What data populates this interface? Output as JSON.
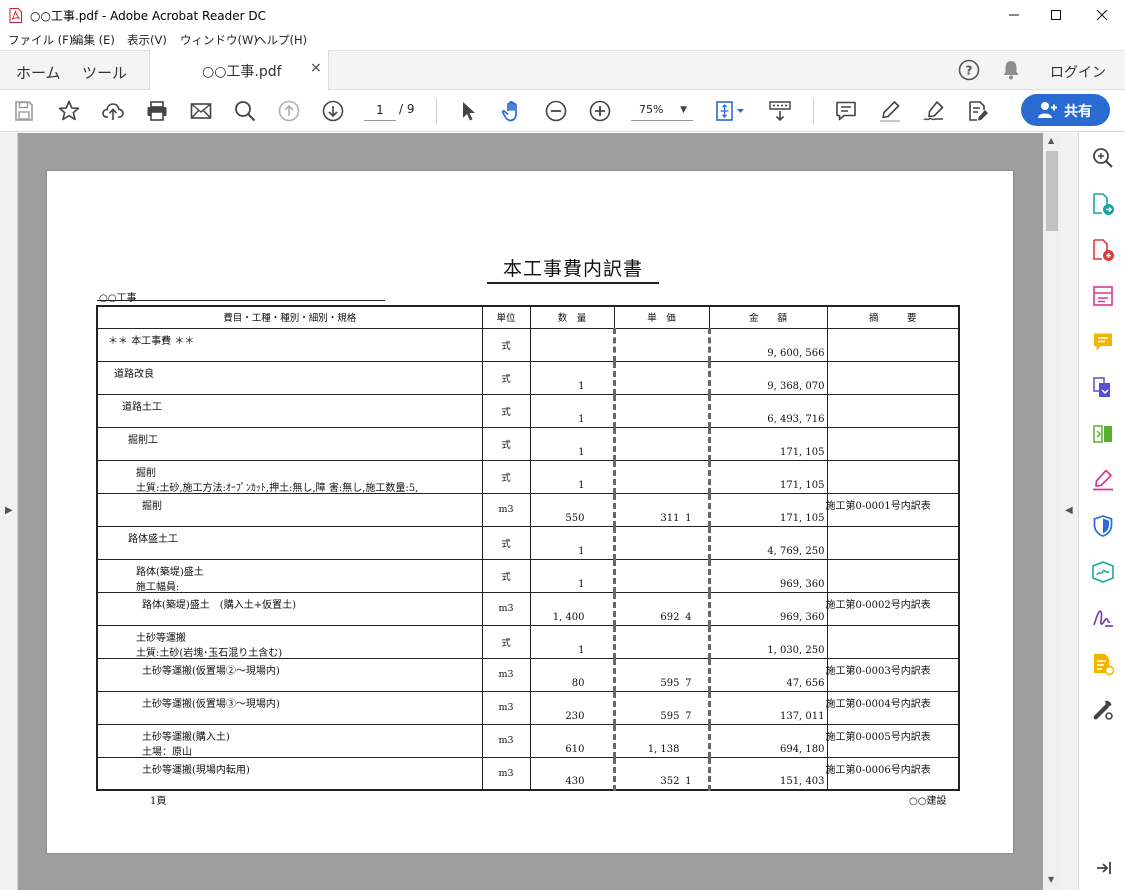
{
  "window": {
    "title": "○○工事.pdf - Adobe Acrobat Reader DC"
  },
  "menu": {
    "items": [
      "ファイル (F)",
      "編集 (E)",
      "表示(V)",
      "ウィンドウ(W)",
      "ヘルプ(H)"
    ]
  },
  "tabs": {
    "home": "ホーム",
    "tools": "ツール",
    "document": "○○工事.pdf",
    "close": "×",
    "login": "ログイン"
  },
  "toolbar": {
    "page_current": "1",
    "page_total": "/ 9",
    "zoom": "75%",
    "share": "共有",
    "accent_color": "#2a6bd1"
  },
  "document": {
    "title": "本工事費内訳書",
    "project": "○○工事",
    "headers": [
      "費目・工種・種別・細別・規格",
      "単位",
      "数　量",
      "単　価",
      "金　　額",
      "摘　　　要"
    ],
    "rows": [
      {
        "l1": "＊＊ 本工事費 ＊＊",
        "l2": "",
        "indent": 10,
        "unit": "式",
        "qty": "",
        "price": "",
        "price_frac": "",
        "amount": "9, 600, 566",
        "note": ""
      },
      {
        "l1": "道路改良",
        "l2": "",
        "indent": 16,
        "unit": "式",
        "qty": "1",
        "price": "",
        "price_frac": "",
        "amount": "9, 368, 070",
        "note": ""
      },
      {
        "l1": "道路土工",
        "l2": "",
        "indent": 24,
        "unit": "式",
        "qty": "1",
        "price": "",
        "price_frac": "",
        "amount": "6, 493, 716",
        "note": ""
      },
      {
        "l1": "掘削工",
        "l2": "",
        "indent": 30,
        "unit": "式",
        "qty": "1",
        "price": "",
        "price_frac": "",
        "amount": "171, 105",
        "note": ""
      },
      {
        "l1": "掘削",
        "l2": "土質:土砂,施工方法:ｵｰﾌﾟﾝｶｯﾄ,押土:無し,障 害:無し,施工数量:5,",
        "indent": 38,
        "l2indent": 38,
        "unit": "式",
        "qty": "1",
        "price": "",
        "price_frac": "",
        "amount": "171, 105",
        "note": ""
      },
      {
        "l1": "掘削",
        "l2": "",
        "indent": 44,
        "unit": "m3",
        "qty": "550",
        "price": "311",
        "price_frac": "1",
        "amount": "171, 105",
        "note": "施工第0-0001号内訳表"
      },
      {
        "l1": "路体盛土工",
        "l2": "",
        "indent": 30,
        "unit": "式",
        "qty": "1",
        "price": "",
        "price_frac": "",
        "amount": "4, 769, 250",
        "note": ""
      },
      {
        "l1": "路体(築堤)盛土",
        "l2": "施工幅員:",
        "indent": 38,
        "l2indent": 38,
        "unit": "式",
        "qty": "1",
        "price": "",
        "price_frac": "",
        "amount": "969, 360",
        "note": ""
      },
      {
        "l1": "路体(築堤)盛土　(購入土+仮置土)",
        "l2": "",
        "indent": 44,
        "unit": "m3",
        "qty": "1, 400",
        "price": "692",
        "price_frac": "4",
        "amount": "969, 360",
        "note": "施工第0-0002号内訳表"
      },
      {
        "l1": "土砂等運搬",
        "l2": "土質:土砂(岩塊･玉石混り土含む)",
        "indent": 38,
        "l2indent": 38,
        "unit": "式",
        "qty": "1",
        "price": "",
        "price_frac": "",
        "amount": "1, 030, 250",
        "note": ""
      },
      {
        "l1": "土砂等運搬(仮置場②～現場内)",
        "l2": "",
        "indent": 44,
        "unit": "m3",
        "qty": "80",
        "price": "595",
        "price_frac": "7",
        "amount": "47, 656",
        "note": "施工第0-0003号内訳表"
      },
      {
        "l1": "土砂等運搬(仮置場③～現場内)",
        "l2": "",
        "indent": 44,
        "unit": "m3",
        "qty": "230",
        "price": "595",
        "price_frac": "7",
        "amount": "137, 011",
        "note": "施工第0-0004号内訳表"
      },
      {
        "l1": "土砂等運搬(購入土)",
        "l2": "土場：原山",
        "indent": 44,
        "l2indent": 44,
        "unit": "m3",
        "qty": "610",
        "price": "1, 138",
        "price_frac": "",
        "amount": "694, 180",
        "note": "施工第0-0005号内訳表"
      },
      {
        "l1": "土砂等運搬(現場内転用)",
        "l2": "",
        "indent": 44,
        "unit": "m3",
        "qty": "430",
        "price": "352",
        "price_frac": "1",
        "amount": "151, 403",
        "note": "施工第0-0006号内訳表"
      }
    ],
    "footer_page": "1頁",
    "footer_company": "○○建設"
  }
}
